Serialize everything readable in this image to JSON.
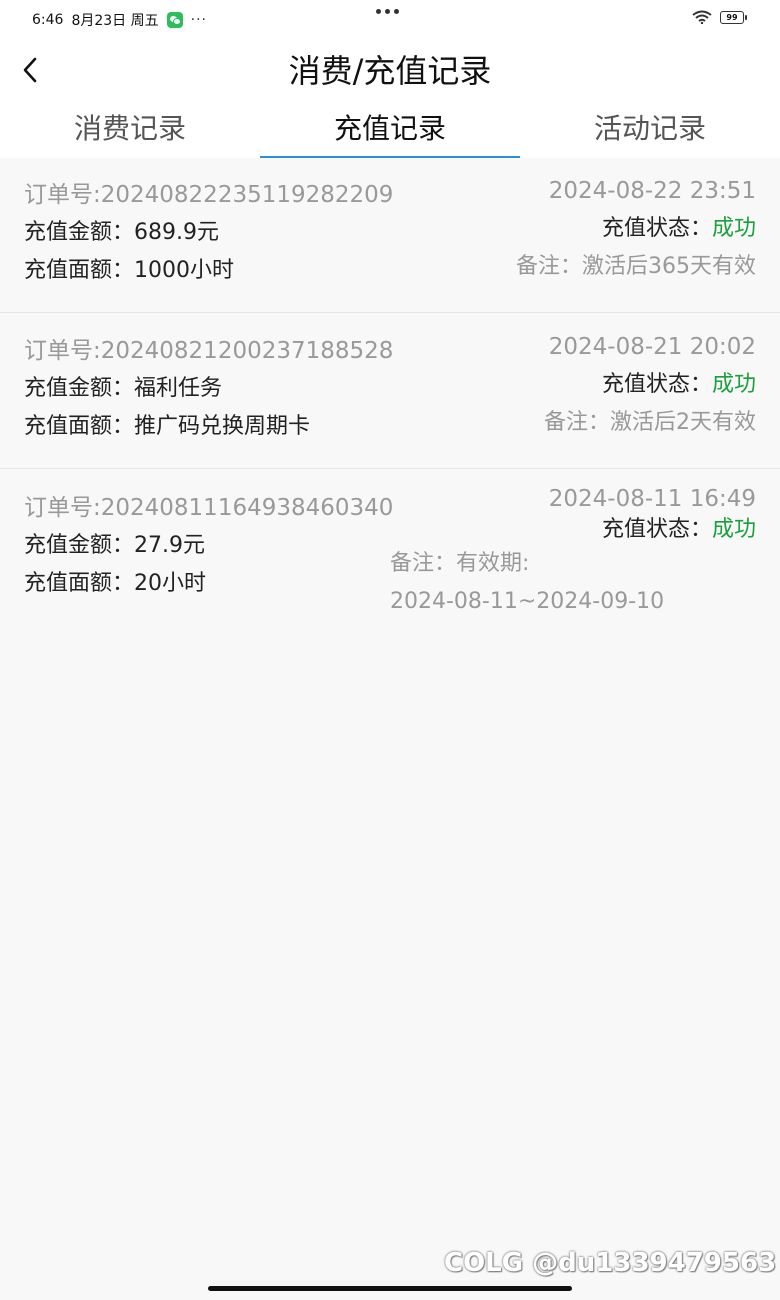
{
  "status_bar": {
    "time": "6:46",
    "date": "8月23日 周五",
    "more": "···",
    "battery": "99"
  },
  "header": {
    "title": "消费/充值记录"
  },
  "tabs": [
    {
      "label": "消费记录"
    },
    {
      "label": "充值记录"
    },
    {
      "label": "活动记录"
    }
  ],
  "records": [
    {
      "order": "订单号:20240822235119282209",
      "datetime": "2024-08-22 23:51",
      "amount": "充值金额：689.9元",
      "face": "充值面额：1000小时",
      "status_label": "充值状态：",
      "status": "成功",
      "note": "备注：激活后365天有效"
    },
    {
      "order": "订单号:20240821200237188528",
      "datetime": "2024-08-21 20:02",
      "amount": "充值金额：福利任务",
      "face": "充值面额：推广码兑换周期卡",
      "status_label": "充值状态：",
      "status": "成功",
      "note": "备注：激活后2天有效"
    },
    {
      "order": "订单号:20240811164938460340",
      "datetime": "2024-08-11 16:49",
      "amount": "充值金额：27.9元",
      "face": "充值面额：20小时",
      "status_label": "充值状态：",
      "status": "成功",
      "note_line1": "备注：有效期:",
      "note_line2": "2024-08-11~2024-09-10"
    }
  ],
  "watermark": "COLG @du1339479563",
  "colors": {
    "accent": "#2d8fd5",
    "success": "#1aa03c",
    "muted": "#999999"
  }
}
